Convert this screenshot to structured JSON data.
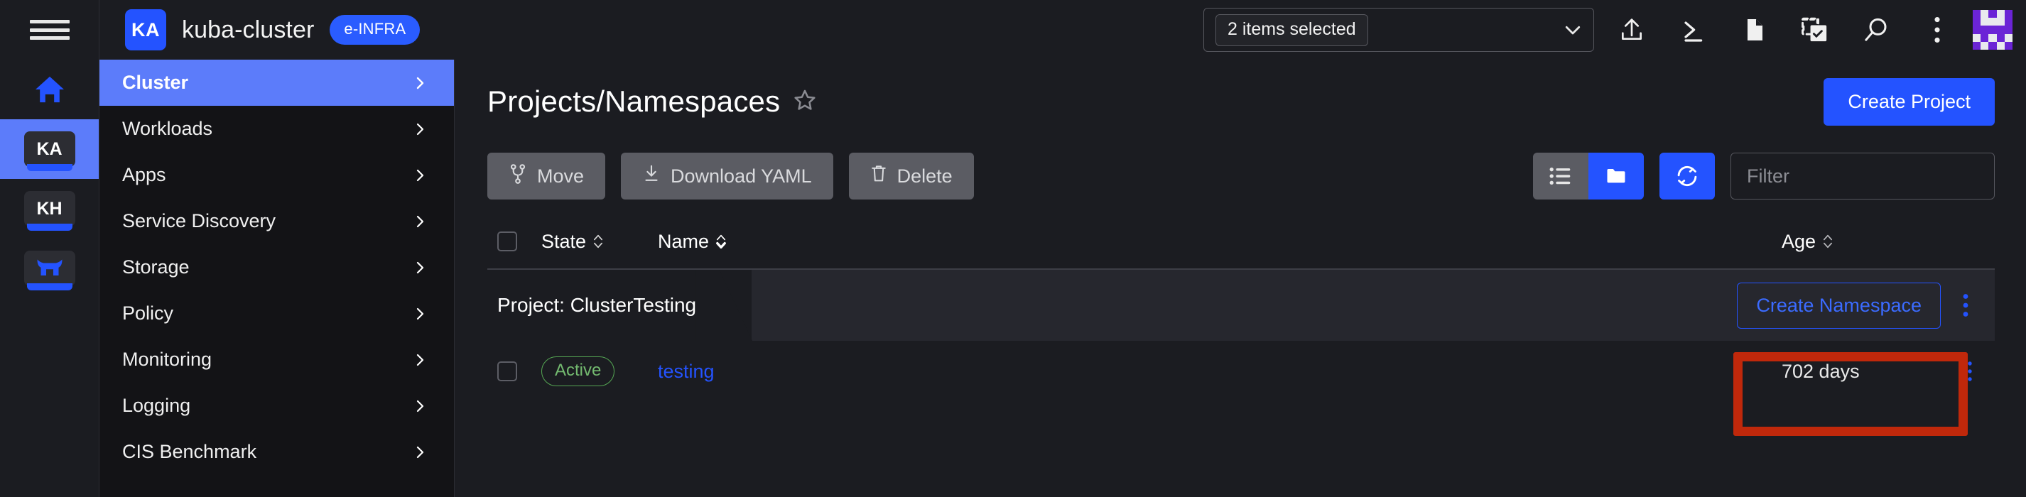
{
  "topbar": {
    "menu_icon": "hamburger-icon",
    "cluster_initials": "KA",
    "cluster_name": "kuba-cluster",
    "cluster_tag": "e-INFRA",
    "namespace_select": {
      "value": "2 items selected",
      "caret_icon": "chevron-down-icon"
    },
    "icons": [
      {
        "name": "upload-icon"
      },
      {
        "name": "terminal-icon"
      },
      {
        "name": "file-icon"
      },
      {
        "name": "import-yaml-icon"
      },
      {
        "name": "search-icon"
      },
      {
        "name": "overflow-menu-icon"
      }
    ],
    "avatar": "user-identicon-avatar"
  },
  "rail": {
    "items": [
      {
        "name": "home",
        "type": "icon",
        "label": "",
        "icon": "home-icon",
        "active": false
      },
      {
        "name": "cluster-ka",
        "type": "badge",
        "label": "KA",
        "active": true
      },
      {
        "name": "cluster-kh",
        "type": "badge",
        "label": "KH",
        "active": false
      },
      {
        "name": "rancher-manager",
        "type": "icon",
        "label": "",
        "icon": "rancher-cow-icon",
        "active": false
      }
    ]
  },
  "nav": {
    "items": [
      {
        "label": "Cluster",
        "active": true
      },
      {
        "label": "Workloads",
        "active": false
      },
      {
        "label": "Apps",
        "active": false
      },
      {
        "label": "Service Discovery",
        "active": false
      },
      {
        "label": "Storage",
        "active": false
      },
      {
        "label": "Policy",
        "active": false
      },
      {
        "label": "Monitoring",
        "active": false
      },
      {
        "label": "Logging",
        "active": false
      },
      {
        "label": "CIS Benchmark",
        "active": false
      }
    ]
  },
  "main": {
    "page_title": "Projects/Namespaces",
    "favorite_icon": "star-outline-icon",
    "create_project_label": "Create Project",
    "actions": [
      {
        "label": "Move",
        "icon": "move-branch-icon"
      },
      {
        "label": "Download YAML",
        "icon": "download-icon"
      },
      {
        "label": "Delete",
        "icon": "trash-icon"
      }
    ],
    "view_toggle": [
      {
        "name": "flat-list-view",
        "icon": "list-icon",
        "active": false
      },
      {
        "name": "group-by-project-view",
        "icon": "folder-icon",
        "active": true
      }
    ],
    "refresh_icon": "refresh-icon",
    "filter": {
      "value": "",
      "placeholder": "Filter"
    },
    "table": {
      "columns": [
        {
          "key": "check",
          "label": ""
        },
        {
          "key": "state",
          "label": "State",
          "sort": "none"
        },
        {
          "key": "name",
          "label": "Name",
          "sort": "asc"
        },
        {
          "key": "age",
          "label": "Age",
          "sort": "none"
        }
      ],
      "groups": [
        {
          "title": "Project: ClusterTesting",
          "create_namespace_label": "Create Namespace",
          "highlighted": true,
          "rows": [
            {
              "state": "Active",
              "name": "testing",
              "age": "702 days"
            }
          ]
        }
      ]
    }
  },
  "colors": {
    "accent_blue": "#2453ff",
    "nav_active": "#5c7cfa",
    "page_bg": "#1b1c21",
    "nav_bg": "#131316",
    "group_bg": "#26272e",
    "grey_btn": "#5b5c63",
    "state_green": "#73b96f",
    "highlight_red": "#c0280b",
    "avatar_purple": "#6b24d6"
  }
}
